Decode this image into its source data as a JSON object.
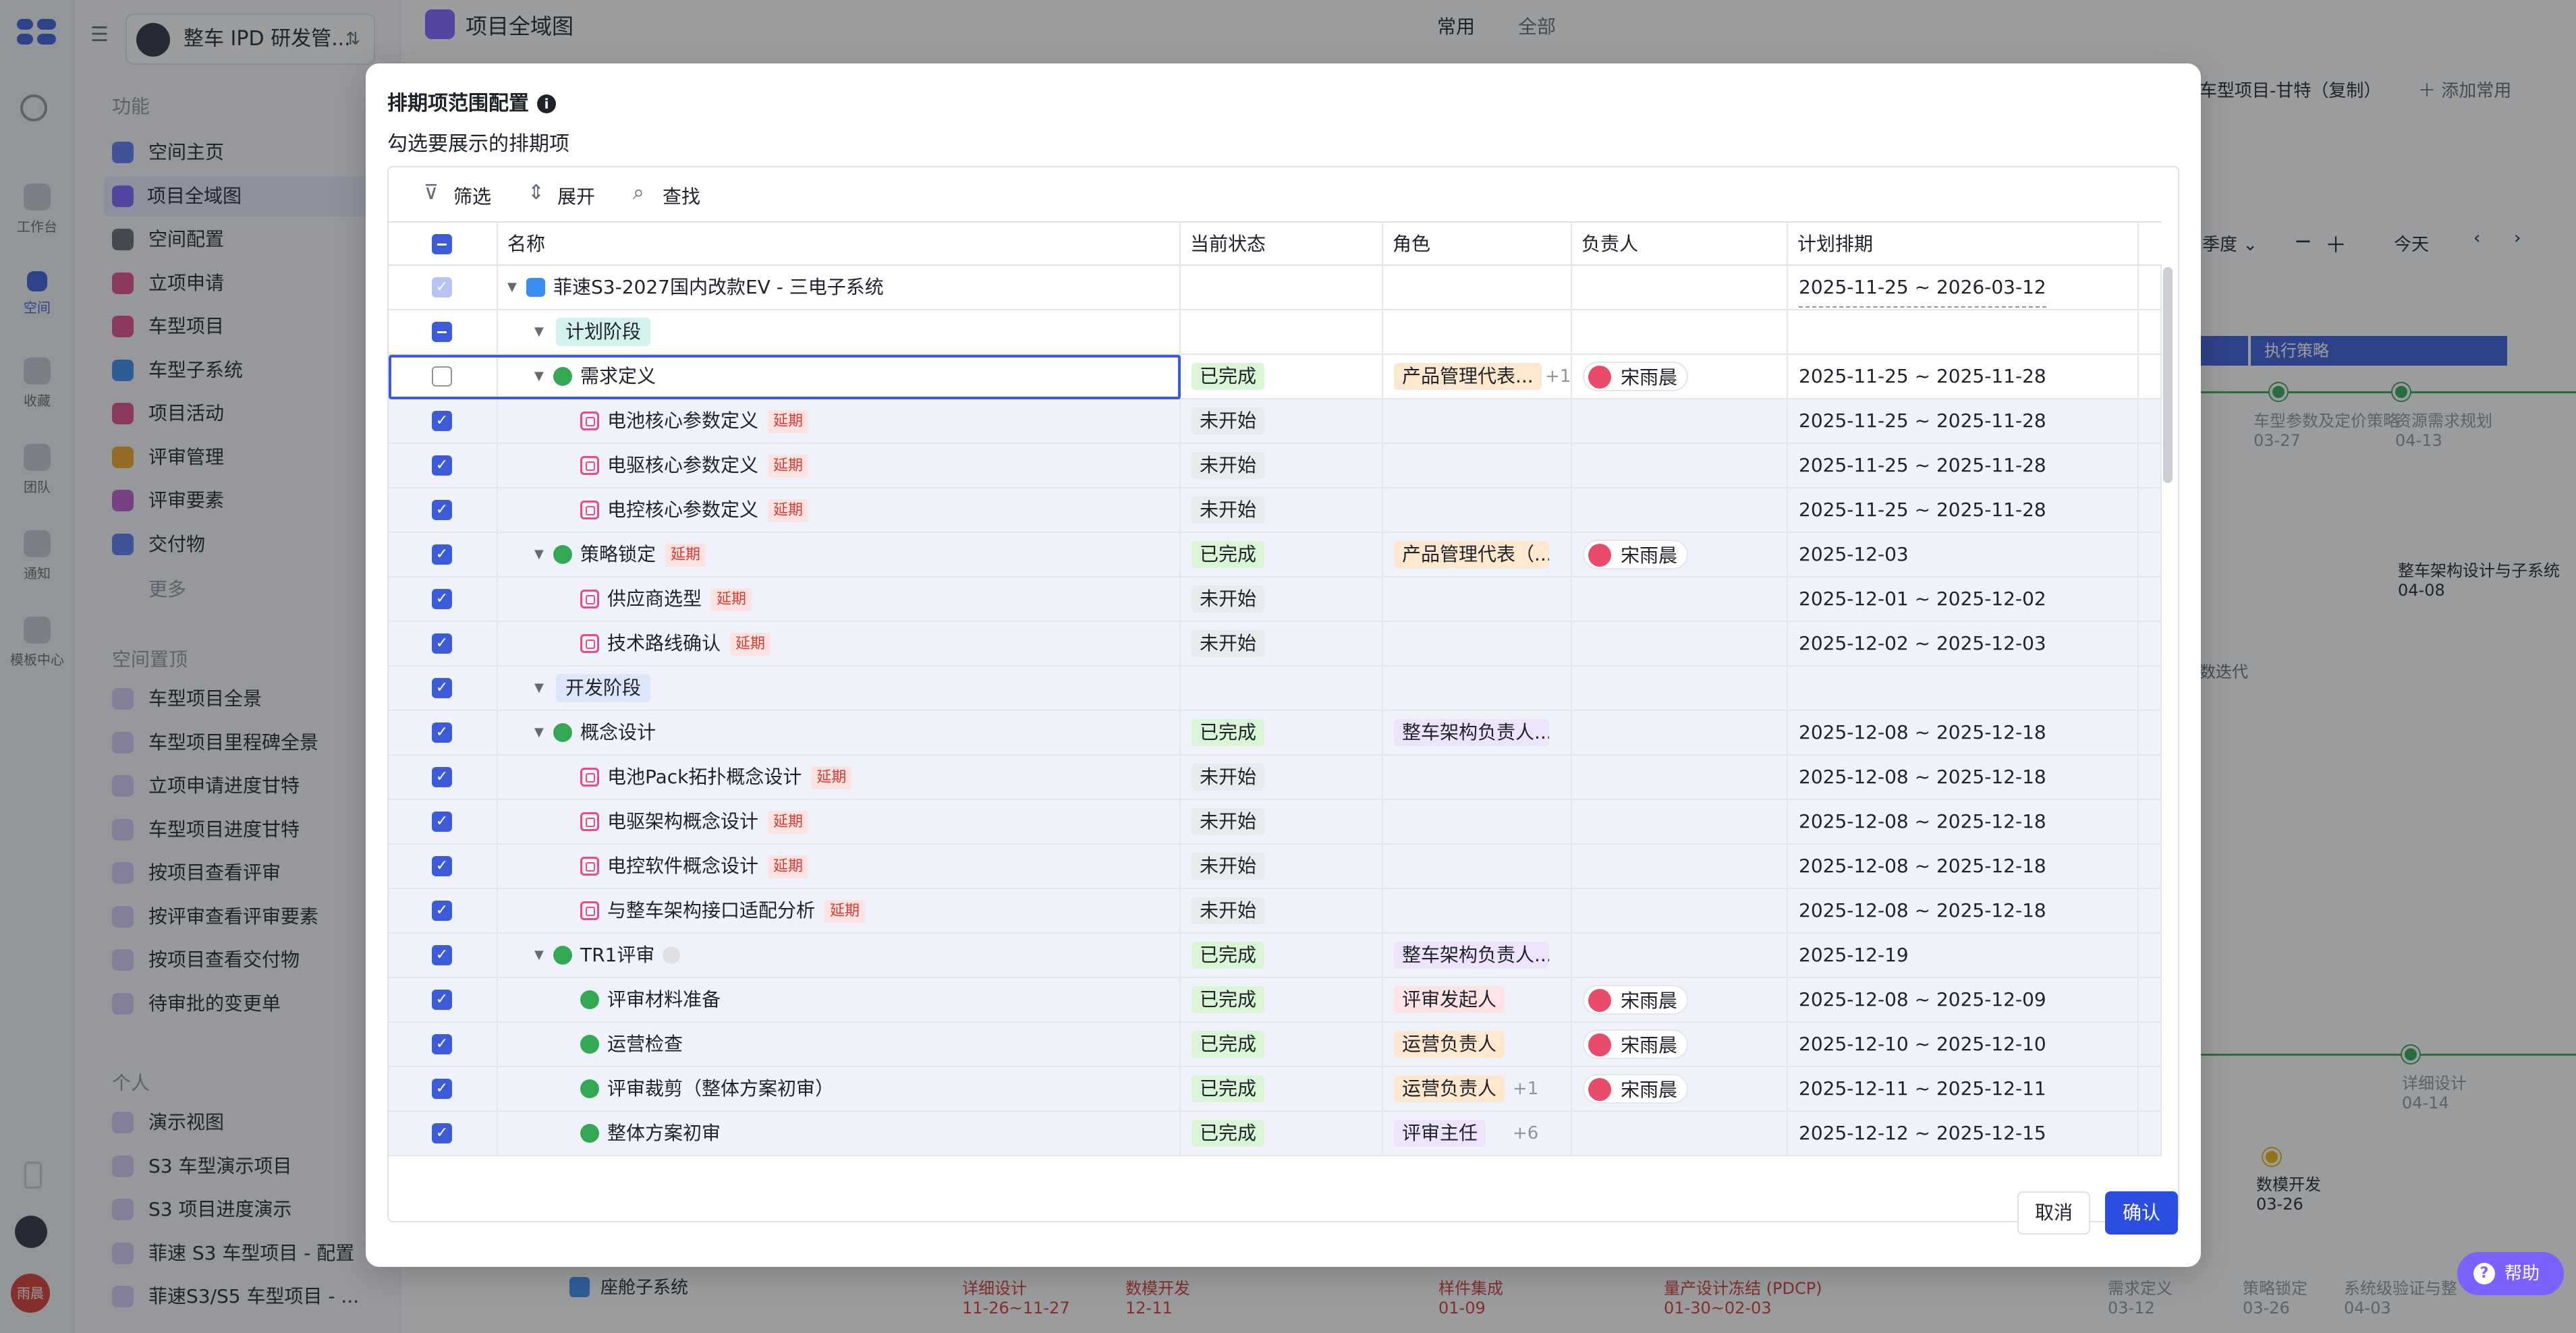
{
  "rail": {
    "items": [
      {
        "label": "工作台"
      },
      {
        "label": "空间"
      },
      {
        "label": "收藏"
      },
      {
        "label": "团队"
      },
      {
        "label": "通知"
      },
      {
        "label": "模板中心"
      }
    ],
    "avatar": "雨晨"
  },
  "sidebar": {
    "space_name": "整车 IPD 研发管...",
    "section_function": "功能",
    "function_items": [
      {
        "label": "空间主页",
        "color": "#5b7bf0"
      },
      {
        "label": "项目全域图",
        "color": "#7b61ff"
      },
      {
        "label": "空间配置",
        "color": "#646a73"
      },
      {
        "label": "立项申请",
        "color": "#e84a8a"
      },
      {
        "label": "车型项目",
        "color": "#e84a8a"
      },
      {
        "label": "车型子系统",
        "color": "#3b8df1"
      },
      {
        "label": "项目活动",
        "color": "#e84a8a"
      },
      {
        "label": "评审管理",
        "color": "#f5a623"
      },
      {
        "label": "评审要素",
        "color": "#c15ad0"
      },
      {
        "label": "交付物",
        "color": "#5b7bf0"
      }
    ],
    "more": "更多",
    "section_pinned": "空间置顶",
    "pinned_items": [
      {
        "label": "车型项目全景"
      },
      {
        "label": "车型项目里程碑全景"
      },
      {
        "label": "立项申请进度甘特"
      },
      {
        "label": "车型项目进度甘特"
      },
      {
        "label": "按项目查看评审"
      },
      {
        "label": "按评审查看评审要素"
      },
      {
        "label": "按项目查看交付物"
      },
      {
        "label": "待审批的变更单"
      }
    ],
    "section_personal": "个人",
    "personal_items": [
      {
        "label": "演示视图"
      },
      {
        "label": "S3 车型演示项目"
      },
      {
        "label": "S3 项目进度演示"
      },
      {
        "label": "菲速 S3 车型项目 - 配置"
      },
      {
        "label": "菲速S3/S5 车型项目 - ..."
      }
    ]
  },
  "main": {
    "title": "项目全域图",
    "tab_common": "常用",
    "tab_all": "全部",
    "view_name": "车型项目-甘特（复制）",
    "add_common": "添加常用",
    "period": "季度",
    "today": "今天",
    "bar_exec": "执行策略",
    "milestones": [
      {
        "label": "车型参数及定价策略",
        "date": "03-27"
      },
      {
        "label": "资源需求规划",
        "date": "04-13"
      },
      {
        "label": "整车架构设计与子系统",
        "date": "04-08"
      },
      {
        "label": "详细设计",
        "date": "04-14"
      },
      {
        "label": "数模开发",
        "date": "03-26"
      }
    ],
    "iter_text": "数迭代",
    "bottom_row": {
      "name": "座舱子系统",
      "items": [
        {
          "label": "详细设计",
          "date": "11-26~11-27"
        },
        {
          "label": "数模开发",
          "date": "12-11"
        },
        {
          "label": "样件集成",
          "date": "01-09"
        },
        {
          "label": "量产设计冻结 (PDCP)",
          "date": "01-30~02-03"
        }
      ],
      "right_items": [
        {
          "label": "需求定义",
          "date": "03-12"
        },
        {
          "label": "策略锁定",
          "date": "03-26"
        },
        {
          "label": "系统级验证与整",
          "date": "04-03"
        }
      ]
    }
  },
  "modal": {
    "title": "排期项范围配置",
    "subtitle": "勾选要展示的排期项",
    "toolbar": {
      "filter": "筛选",
      "expand": "展开",
      "find": "查找"
    },
    "columns": {
      "name": "名称",
      "status": "当前状态",
      "role": "角色",
      "owner": "负责人",
      "schedule": "计划排期"
    },
    "delay_label": "延期",
    "rows": [
      {
        "check": "disabled",
        "indent": 0,
        "caret": true,
        "icon": "blue",
        "name": "菲速S3-2027国内改款EV - 三电子系统",
        "delay": false,
        "status": "",
        "role": "",
        "role_color": "",
        "role_more": "",
        "owner": "",
        "schedule": "2025-11-25 ~ 2026-03-12",
        "dashed": true
      },
      {
        "check": "indet",
        "indent": 1,
        "caret": true,
        "icon": "stage-green",
        "name": "计划阶段",
        "delay": false,
        "status": "",
        "role": "",
        "role_color": "",
        "role_more": "",
        "owner": "",
        "schedule": ""
      },
      {
        "check": "empty",
        "indent": 1,
        "caret": true,
        "icon": "green-circle",
        "name": "需求定义",
        "delay": false,
        "status": "已完成",
        "role": "产品管理代表...",
        "role_color": "orange",
        "role_more": "+1",
        "owner": "宋雨晨",
        "schedule": "2025-11-25 ~ 2025-11-28",
        "focus": true
      },
      {
        "check": "on",
        "indent": 2,
        "caret": false,
        "icon": "task",
        "name": "电池核心参数定义",
        "delay": true,
        "status": "未开始",
        "role": "",
        "role_color": "",
        "role_more": "",
        "owner": "",
        "schedule": "2025-11-25 ~ 2025-11-28"
      },
      {
        "check": "on",
        "indent": 2,
        "caret": false,
        "icon": "task",
        "name": "电驱核心参数定义",
        "delay": true,
        "status": "未开始",
        "role": "",
        "role_color": "",
        "role_more": "",
        "owner": "",
        "schedule": "2025-11-25 ~ 2025-11-28"
      },
      {
        "check": "on",
        "indent": 2,
        "caret": false,
        "icon": "task",
        "name": "电控核心参数定义",
        "delay": true,
        "status": "未开始",
        "role": "",
        "role_color": "",
        "role_more": "",
        "owner": "",
        "schedule": "2025-11-25 ~ 2025-11-28"
      },
      {
        "check": "on",
        "indent": 1,
        "caret": true,
        "icon": "flag",
        "name": "策略锁定",
        "delay": true,
        "status": "已完成",
        "role": "产品管理代表（...",
        "role_color": "orange",
        "role_more": "",
        "owner": "宋雨晨",
        "schedule": "2025-12-03"
      },
      {
        "check": "on",
        "indent": 2,
        "caret": false,
        "icon": "task",
        "name": "供应商选型",
        "delay": true,
        "status": "未开始",
        "role": "",
        "role_color": "",
        "role_more": "",
        "owner": "",
        "schedule": "2025-12-01 ~ 2025-12-02"
      },
      {
        "check": "on",
        "indent": 2,
        "caret": false,
        "icon": "task",
        "name": "技术路线确认",
        "delay": true,
        "status": "未开始",
        "role": "",
        "role_color": "",
        "role_more": "",
        "owner": "",
        "schedule": "2025-12-02 ~ 2025-12-03"
      },
      {
        "check": "on",
        "indent": 1,
        "caret": true,
        "icon": "stage-blue",
        "name": "开发阶段",
        "delay": false,
        "status": "",
        "role": "",
        "role_color": "",
        "role_more": "",
        "owner": "",
        "schedule": ""
      },
      {
        "check": "on",
        "indent": 1,
        "caret": true,
        "icon": "green-circle",
        "name": "概念设计",
        "delay": false,
        "status": "已完成",
        "role": "整车架构负责人...",
        "role_color": "purple",
        "role_more": "",
        "owner": "",
        "schedule": "2025-12-08 ~ 2025-12-18"
      },
      {
        "check": "on",
        "indent": 2,
        "caret": false,
        "icon": "task",
        "name": "电池Pack拓扑概念设计",
        "delay": true,
        "status": "未开始",
        "role": "",
        "role_color": "",
        "role_more": "",
        "owner": "",
        "schedule": "2025-12-08 ~ 2025-12-18"
      },
      {
        "check": "on",
        "indent": 2,
        "caret": false,
        "icon": "task",
        "name": "电驱架构概念设计",
        "delay": true,
        "status": "未开始",
        "role": "",
        "role_color": "",
        "role_more": "",
        "owner": "",
        "schedule": "2025-12-08 ~ 2025-12-18"
      },
      {
        "check": "on",
        "indent": 2,
        "caret": false,
        "icon": "task",
        "name": "电控软件概念设计",
        "delay": true,
        "status": "未开始",
        "role": "",
        "role_color": "",
        "role_more": "",
        "owner": "",
        "schedule": "2025-12-08 ~ 2025-12-18"
      },
      {
        "check": "on",
        "indent": 2,
        "caret": false,
        "icon": "task",
        "name": "与整车架构接口适配分析",
        "delay": true,
        "status": "未开始",
        "role": "",
        "role_color": "",
        "role_more": "",
        "owner": "",
        "schedule": "2025-12-08 ~ 2025-12-18"
      },
      {
        "check": "on",
        "indent": 1,
        "caret": true,
        "icon": "flag",
        "name": "TR1评审",
        "delay": false,
        "greydot": true,
        "status": "已完成",
        "role": "整车架构负责人...",
        "role_color": "purple",
        "role_more": "",
        "owner": "",
        "schedule": "2025-12-19"
      },
      {
        "check": "on",
        "indent": 2,
        "caret": false,
        "icon": "green-circle",
        "name": "评审材料准备",
        "delay": false,
        "status": "已完成",
        "role": "评审发起人",
        "role_color": "pink",
        "role_more": "",
        "owner": "宋雨晨",
        "schedule": "2025-12-08 ~ 2025-12-09"
      },
      {
        "check": "on",
        "indent": 2,
        "caret": false,
        "icon": "green-circle",
        "name": "运营检查",
        "delay": false,
        "status": "已完成",
        "role": "运营负责人",
        "role_color": "orange",
        "role_more": "",
        "owner": "宋雨晨",
        "schedule": "2025-12-10 ~ 2025-12-10"
      },
      {
        "check": "on",
        "indent": 2,
        "caret": false,
        "icon": "green-circle",
        "name": "评审裁剪（整体方案初审）",
        "delay": false,
        "status": "已完成",
        "role": "运营负责人",
        "role_color": "orange",
        "role_more": "+1",
        "owner": "宋雨晨",
        "schedule": "2025-12-11 ~ 2025-12-11"
      },
      {
        "check": "on",
        "indent": 2,
        "caret": false,
        "icon": "green-circle",
        "name": "整体方案初审",
        "delay": false,
        "status": "已完成",
        "role": "评审主任",
        "role_color": "purple",
        "role_more": "+6",
        "owner": "",
        "schedule": "2025-12-12 ~ 2025-12-15"
      }
    ],
    "cancel": "取消",
    "confirm": "确认"
  },
  "help": "帮助"
}
